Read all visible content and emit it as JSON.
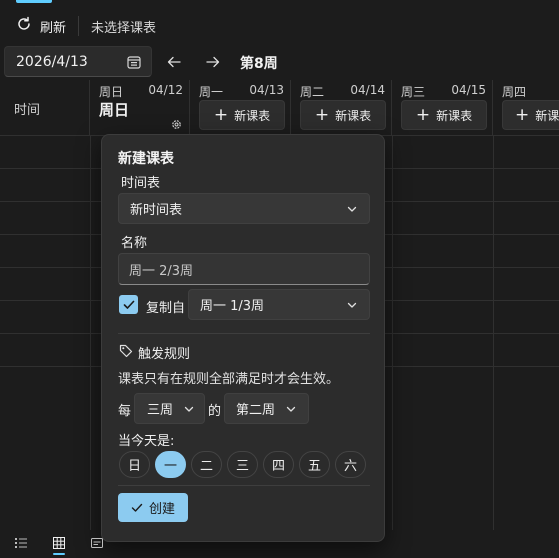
{
  "toolbar": {
    "refresh_label": "刷新",
    "status_text": "未选择课表"
  },
  "datebar": {
    "date_value": "2026/4/13",
    "week_label": "第8周"
  },
  "grid": {
    "time_header": "时间",
    "days": [
      {
        "weekday": "周日",
        "date": "04/12",
        "title": "周日"
      },
      {
        "weekday": "周一",
        "date": "04/13",
        "button": "新课表"
      },
      {
        "weekday": "周二",
        "date": "04/14",
        "button": "新课表"
      },
      {
        "weekday": "周三",
        "date": "04/15",
        "button": "新课表"
      },
      {
        "weekday": "周四",
        "date": "",
        "button": "新课"
      }
    ]
  },
  "popup": {
    "title": "新建课表",
    "timetable_label": "时间表",
    "timetable_value": "新时间表",
    "name_label": "名称",
    "name_value": "周一 2/3周",
    "copy_label": "复制自",
    "copy_value": "周一 1/3周",
    "trigger_title": "触发规则",
    "trigger_desc": "课表只有在规则全部满足时才会生效。",
    "every_label": "每",
    "period_value": "三周",
    "of_label": "的",
    "which_value": "第二周",
    "today_label": "当今天是:",
    "weekdays": [
      "日",
      "一",
      "二",
      "三",
      "四",
      "五",
      "六"
    ],
    "selected_weekday": "一",
    "create_label": "创建"
  },
  "colors": {
    "accent": "#8ccbf0",
    "background": "#1c1c1c",
    "popup_bg": "#2c2c2c"
  }
}
